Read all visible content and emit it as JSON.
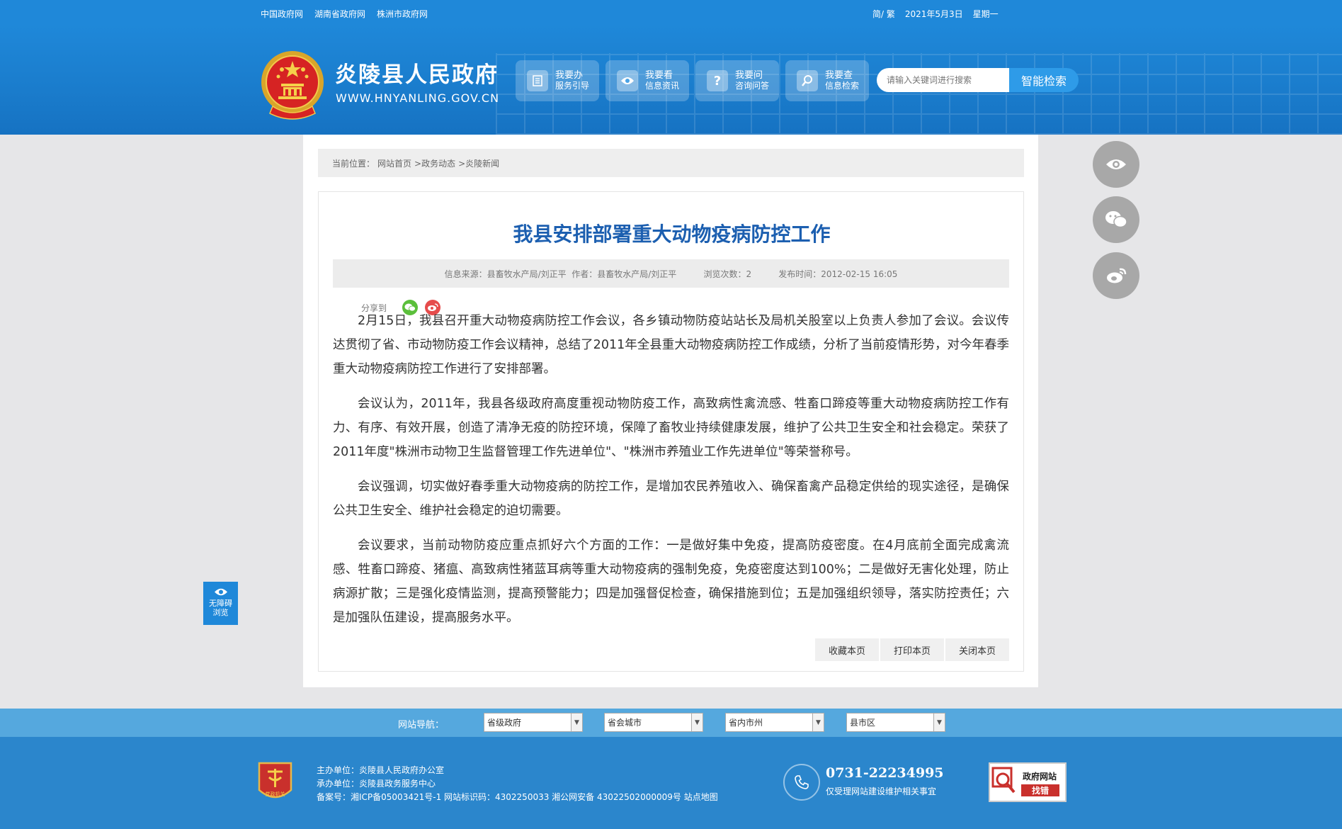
{
  "topbar": {
    "links": [
      "中国政府网",
      "湖南省政府网",
      "株洲市政府网"
    ],
    "lang": "简/ 繁",
    "date": "2021年5月3日",
    "weekday": "星期一"
  },
  "header": {
    "site_name": "炎陵县人民政府",
    "site_url": "WWW.HNYANLING.GOV.CN",
    "quick_links": [
      {
        "title": "我要办",
        "sub": "服务引导",
        "icon": "document-icon"
      },
      {
        "title": "我要看",
        "sub": "信息资讯",
        "icon": "eye-icon"
      },
      {
        "title": "我要问",
        "sub": "咨询问答",
        "icon": "question-icon"
      },
      {
        "title": "我要查",
        "sub": "信息检索",
        "icon": "search-icon"
      }
    ],
    "search_placeholder": "请输入关键词进行搜索",
    "search_button": "智能检索"
  },
  "breadcrumb": {
    "label": "当前位置：",
    "items": [
      "网站首页",
      ">政务动态",
      ">炎陵新闻"
    ]
  },
  "article": {
    "title": "我县安排部署重大动物疫病防控工作",
    "meta": {
      "source": "信息来源：县畜牧水产局/刘正平",
      "author": "作者：县畜牧水产局/刘正平",
      "views": "浏览次数：2",
      "published": "发布时间：2012-02-15 16:05"
    },
    "share_label": "分享到",
    "paragraphs": [
      "2月15日，我县召开重大动物疫病防控工作会议，各乡镇动物防疫站站长及局机关股室以上负责人参加了会议。会议传达贯彻了省、市动物防疫工作会议精神，总结了2011年全县重大动物疫病防控工作成绩，分析了当前疫情形势，对今年春季重大动物疫病防控工作进行了安排部署。",
      "会议认为，2011年，我县各级政府高度重视动物防疫工作，高致病性禽流感、牲畜口蹄疫等重大动物疫病防控工作有力、有序、有效开展，创造了清净无疫的防控环境，保障了畜牧业持续健康发展，维护了公共卫生安全和社会稳定。荣获了2011年度\"株洲市动物卫生监督管理工作先进单位\"、\"株洲市养殖业工作先进单位\"等荣誉称号。",
      "会议强调，切实做好春季重大动物疫病的防控工作，是增加农民养殖收入、确保畜禽产品稳定供给的现实途径，是确保公共卫生安全、维护社会稳定的迫切需要。",
      "会议要求，当前动物防疫应重点抓好六个方面的工作：一是做好集中免疫，提高防疫密度。在4月底前全面完成禽流感、牲畜口蹄疫、猪瘟、高致病性猪蓝耳病等重大动物疫病的强制免疫，免疫密度达到100%；二是做好无害化处理，防止病源扩散；三是强化疫情监测，提高预警能力；四是加强督促检查，确保措施到位；五是加强组织领导，落实防控责任；六是加强队伍建设，提高服务水平。"
    ],
    "actions": [
      "收藏本页",
      "打印本页",
      "关闭本页"
    ]
  },
  "accessibility": {
    "line1": "无障碍",
    "line2": "浏览"
  },
  "site_nav": {
    "label": "网站导航：",
    "selects": [
      "省级政府",
      "省会城市",
      "省内市州",
      "县市区"
    ]
  },
  "footer": {
    "host": "主办单位：炎陵县人民政府办公室",
    "operator": "承办单位：炎陵县政务服务中心",
    "record": "备案号：湘ICP备05003421号-1 网站标识码：4302250033 湘公网安备 43022502000009号 站点地图",
    "phone": "0731-22234995",
    "phone_note": "仅受理网站建设维护相关事宜",
    "badge_text": "党政机关",
    "error_badge": {
      "line1": "政府网站",
      "line2": "找错"
    }
  },
  "colors": {
    "primary": "#1f88d9",
    "title_blue": "#1c5fb0",
    "footer": "#2b86cc",
    "nav": "#55a8de"
  }
}
